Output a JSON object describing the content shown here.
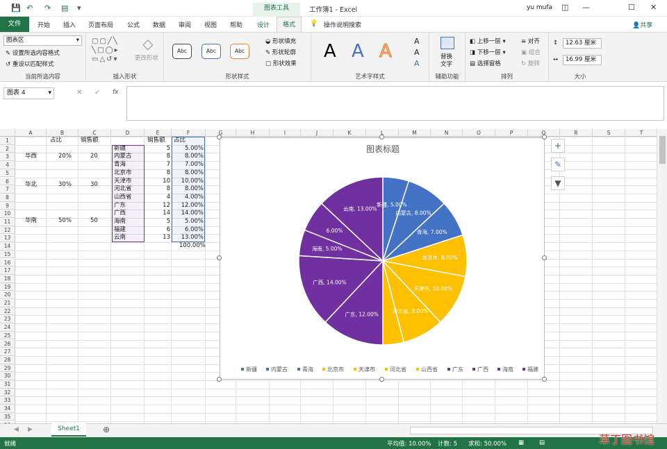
{
  "title_bar": {
    "doc": "工作簿1 - Excel",
    "chart_tools": "图表工具",
    "user": "yu mufa"
  },
  "ribbon_tabs": {
    "file": "文件",
    "home": "开始",
    "insert": "插入",
    "layout": "页面布局",
    "formula": "公式",
    "data": "数据",
    "review": "审阅",
    "view": "视图",
    "help": "帮助",
    "design": "设计",
    "format": "格式",
    "tell": "操作说明搜索",
    "share": "共享"
  },
  "ribbon": {
    "current_selection": {
      "dropdown": "图表区",
      "format_sel": "设置所选内容格式",
      "reset": "重设以匹配样式",
      "label": "当前所选内容"
    },
    "insert_shapes": {
      "change": "更改形状",
      "label": "插入形状"
    },
    "shape_styles": {
      "sample": "Abc",
      "fill": "形状填充",
      "outline": "形状轮廓",
      "effects": "形状效果",
      "label": "形状样式"
    },
    "wordart": {
      "a": "A",
      "label": "艺术字样式"
    },
    "accessibility": {
      "alt": "替换",
      "alt2": "文字",
      "label": "辅助功能"
    },
    "arrange": {
      "forward": "上移一层",
      "backward": "下移一层",
      "pane": "选择窗格",
      "align": "对齐",
      "group": "组合",
      "rotate": "旋转",
      "label": "排列"
    },
    "size": {
      "height": "12.63 厘米",
      "width": "16.99 厘米",
      "label": "大小"
    }
  },
  "formula_bar": {
    "namebox": "图表 4",
    "fx": "fx"
  },
  "columns": [
    "A",
    "B",
    "C",
    "D",
    "E",
    "F",
    "G",
    "H",
    "I",
    "J",
    "K",
    "L",
    "M",
    "N",
    "O",
    "P",
    "Q",
    "R",
    "S",
    "T"
  ],
  "rows": [
    "1",
    "2",
    "3",
    "4",
    "5",
    "6",
    "7",
    "8",
    "9",
    "10",
    "11",
    "12",
    "13",
    "14",
    "15",
    "16",
    "17",
    "18",
    "19",
    "20",
    "21",
    "22",
    "23",
    "24",
    "25",
    "26",
    "27",
    "28",
    "29",
    "30",
    "31",
    "32",
    "33",
    "34",
    "35",
    "36"
  ],
  "cells": {
    "b1": "占比",
    "c1": "销售额",
    "a3": "华西",
    "b3": "20%",
    "c3": "20",
    "a6": "华北",
    "b6": "30%",
    "c6": "30",
    "a10": "华南",
    "b10": "50%",
    "c10": "50",
    "e1": "销售额",
    "f1": "占比",
    "provinces": [
      "新疆",
      "内蒙古",
      "青海",
      "北京市",
      "天津市",
      "河北省",
      "山西省",
      "广东",
      "广西",
      "海南",
      "福建",
      "云南"
    ],
    "sales": [
      "5",
      "8",
      "7",
      "8",
      "10",
      "8",
      "4",
      "12",
      "14",
      "5",
      "6",
      "13"
    ],
    "pct": [
      "5.00%",
      "8.00%",
      "7.00%",
      "8.00%",
      "10.00%",
      "8.00%",
      "4.00%",
      "12.00%",
      "14.00%",
      "5.00%",
      "6.00%",
      "13.00%"
    ],
    "f14": "100.00%"
  },
  "chart_data": {
    "type": "pie",
    "title": "图表标题",
    "categories": [
      "新疆",
      "内蒙古",
      "青海",
      "北京市",
      "天津市",
      "河北省",
      "山西省",
      "广东",
      "广西",
      "海南",
      "福建",
      "云南"
    ],
    "values": [
      5,
      8,
      7,
      8,
      10,
      8,
      4,
      12,
      14,
      5,
      6,
      13
    ],
    "labels": [
      "新疆, 5.00%",
      "内蒙古, 8.00%",
      "青海, 7.00%",
      "北京市, 8.00%",
      "天津市, 10.00%",
      "河北省, 8.00%",
      "",
      "广东, 12.00%",
      "广西, 14.00%",
      "海南, 5.00%",
      "6.00%",
      "云南, 13.00%"
    ],
    "colors": [
      "#4472c4",
      "#4472c4",
      "#4472c4",
      "#ffc000",
      "#ffc000",
      "#ffc000",
      "#ffc000",
      "#7030a0",
      "#7030a0",
      "#7030a0",
      "#7030a0",
      "#7030a0"
    ],
    "legend_position": "bottom"
  },
  "sheet": {
    "name": "Sheet1"
  },
  "status": {
    "ready": "就绪",
    "avg": "平均值: 10.00%",
    "count": "计数: 5",
    "sum": "求和: 50.00%"
  },
  "watermark": "草丁图书馆"
}
